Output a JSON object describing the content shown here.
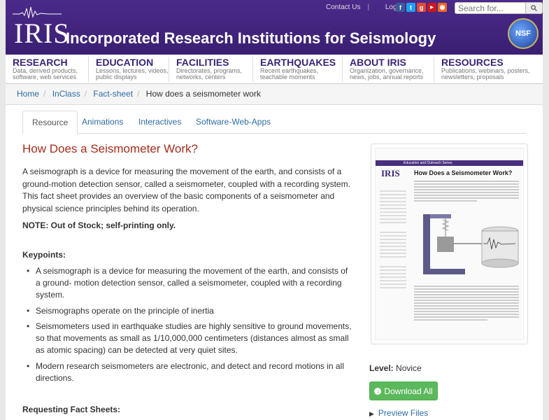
{
  "header": {
    "logo_text": "IRIS",
    "title": "Incorporated Research Institutions for Seismology",
    "links": [
      "Contact Us",
      "Login"
    ],
    "social_icons": [
      "facebook-icon",
      "twitter-icon",
      "google-plus-icon",
      "youtube-icon",
      "rss-icon"
    ],
    "search_placeholder": "Search for...",
    "badge_text": "NSF"
  },
  "nav": [
    {
      "title": "RESEARCH",
      "sub": "Data, derived products, software, web services"
    },
    {
      "title": "EDUCATION",
      "sub": "Lessons, lectures, videos, public displays"
    },
    {
      "title": "FACILITIES",
      "sub": "Directorates, programs, networks, centers"
    },
    {
      "title": "EARTHQUAKES",
      "sub": "Recent earthquakes, teachable moments"
    },
    {
      "title": "ABOUT IRIS",
      "sub": "Organization, governance, news, jobs, annual reports"
    },
    {
      "title": "RESOURCES",
      "sub": "Publications, webinars, posters, newsletters, proposals"
    }
  ],
  "breadcrumb": [
    "Home",
    "InClass",
    "Fact-sheet",
    "How does a seismometer work"
  ],
  "tabs": [
    "Resource",
    "Animations",
    "Interactives",
    "Software-Web-Apps"
  ],
  "main": {
    "title": "How Does a Seismometer Work?",
    "intro": "A seismograph is a device for measuring the movement of the earth, and consists of a ground-motion detection sensor, called a seismometer, coupled with a recording system. This fact sheet provides an overview of the basic components of a seismometer and physical science principles behind its operation.",
    "note": "NOTE: Out of Stock; self-printing only.",
    "keypoints_label": "Keypoints:",
    "keypoints": [
      "A seismograph is a device for measuring the movement of the earth, and consists of a ground- motion detection sensor, called a seismometer, coupled with a recording system.",
      "Seismographs operate on the principle of inertia",
      "Seismometers used in earthquake studies are highly sensitive to ground movements, so that movements as small as 1/10,000,000 centimeters (distances almost as small as atomic spacing) can be detected at very quiet sites.",
      "Modern research seismometers are electronic, and detect and record motions in all directions."
    ],
    "requesting_label": "Requesting Fact Sheets:"
  },
  "sidebar": {
    "thumbnail": {
      "series": "Education and Outreach Series",
      "logo": "IRIS",
      "title": "How Does a Seismometer Work?"
    },
    "level_label": "Level:",
    "level_value": "Novice",
    "download_label": "Download All",
    "preview_label": "Preview Files"
  }
}
